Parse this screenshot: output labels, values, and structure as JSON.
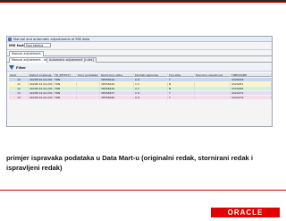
{
  "screenshot": {
    "window_title": "Manual and automatic adjustments of MIS data",
    "form_label": "MIS facts",
    "form_value": "Fact tablica",
    "tabs_primary": [
      "Manual adjustment"
    ],
    "tabs_secondary": [
      "Manual adjustment - data",
      "Automatic adjustment [rules]"
    ],
    "toolbar": {
      "filter_label": "Filter"
    },
    "columns": [
      "Verzi",
      "Datum knjizenja",
      "TD_EFFECTI",
      "Izvor podataka",
      "Redni broj retka",
      "Pondati zapisnika",
      "Tip retka",
      "Trenutna relevitnost",
      "TIMESTAMP"
    ],
    "rows": [
      [
        "10",
        "40298 22.04.2010",
        "TRN",
        "",
        "38558449",
        "0 O",
        "Y",
        "4329078"
      ],
      [
        "11",
        "40298 22.04.2010",
        "TRN",
        "",
        "38558449",
        "1 S",
        "N",
        "4324281"
      ],
      [
        "12",
        "40298 22.04.2010",
        "TRN",
        "",
        "38558449",
        "2 C",
        "N",
        "4324282"
      ],
      [
        "13",
        "40298 22.04.2010",
        "TRN",
        "",
        "38558457",
        "0 O",
        "Y",
        "4324279"
      ],
      [
        "14",
        "40298 22.04.2010",
        "TRN",
        "",
        "38558460",
        "0 O",
        "Y",
        "4324279"
      ]
    ]
  },
  "caption": {
    "line1": "primjer ispravaka podataka u Data Mart-u (originalni redak, stornirani redak i",
    "line2": "ispravljeni redak)"
  },
  "footer": {
    "logo_text": "ORACLE"
  }
}
